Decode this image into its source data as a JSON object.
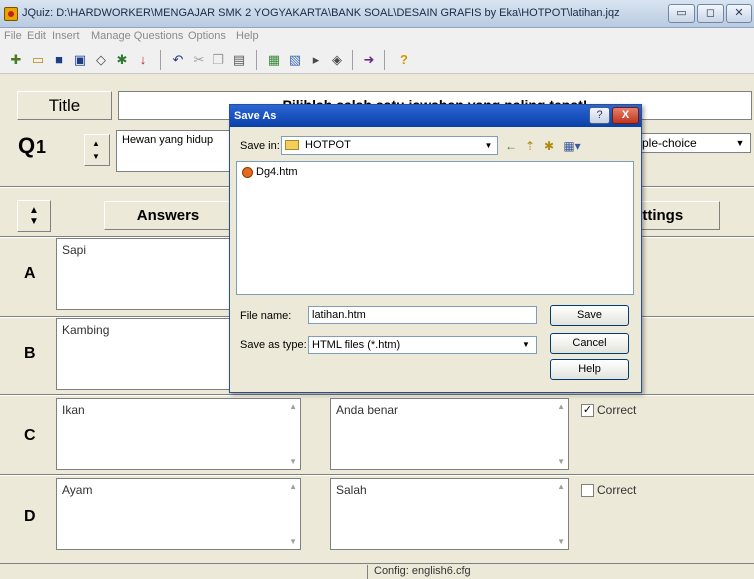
{
  "window": {
    "title": "JQuiz: D:\\HARDWORKER\\MENGAJAR SMK 2 YOGYAKARTA\\BANK SOAL\\DESAIN GRAFIS by Eka\\HOTPOT\\latihan.jqz",
    "minimize_glyph": "▭",
    "maximize_glyph": "◻",
    "close_glyph": "✕"
  },
  "menu": {
    "file": "File",
    "edit": "Edit",
    "insert": "Insert",
    "manage_questions": "Manage Questions",
    "options": "Options",
    "help": "Help"
  },
  "toolbar": {
    "icons": [
      "new-file-icon",
      "open-folder-icon",
      "save-icon",
      "save-as-icon",
      "tag-icon",
      "export-icon",
      "down-arrow-icon",
      "undo-icon",
      "cut-icon",
      "copy-icon",
      "paste-icon",
      "add-picture-icon",
      "insert-image-icon",
      "play-icon",
      "web-icon",
      "arrow-icon",
      "help-icon"
    ]
  },
  "editor": {
    "title_label": "Title",
    "title_value": "Pilihlah salah satu jawaban yang paling tepat!",
    "q_label": "Q",
    "q_number": "1",
    "question_text": "Hewan yang hidup",
    "question_type": "ple-choice",
    "answers_header": "Answers",
    "settings_header": "ettings",
    "answers": [
      {
        "letter": "A",
        "text": "Sapi",
        "feedback": "",
        "correct": false,
        "show_correct": false
      },
      {
        "letter": "B",
        "text": "Kambing",
        "feedback": "",
        "correct": false,
        "show_correct": false
      },
      {
        "letter": "C",
        "text": "Ikan",
        "feedback": "Anda benar",
        "correct": true,
        "show_correct": true
      },
      {
        "letter": "D",
        "text": "Ayam",
        "feedback": "Salah",
        "correct": false,
        "show_correct": true
      }
    ],
    "correct_label": "Correct",
    "check_mark": "✓",
    "status": "Config: english6.cfg"
  },
  "save_dialog": {
    "title": "Save As",
    "help_glyph": "?",
    "close_glyph": "X",
    "save_in_label": "Save in:",
    "save_in_value": "HOTPOT",
    "files": [
      "Dg4.htm"
    ],
    "filename_label": "File name:",
    "filename_value": "latihan.htm",
    "filetype_label": "Save as type:",
    "filetype_value": "HTML files (*.htm)",
    "save_button": "Save",
    "cancel_button": "Cancel",
    "help_button": "Help"
  }
}
